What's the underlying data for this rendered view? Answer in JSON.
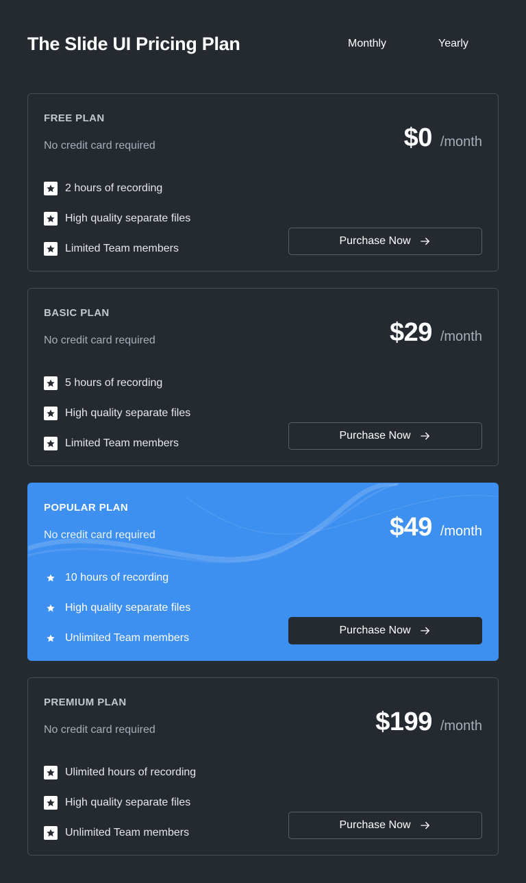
{
  "header": {
    "title": "The Slide UI Pricing Plan",
    "toggle": {
      "monthly_label": "Monthly",
      "yearly_label": "Yearly"
    }
  },
  "plans": [
    {
      "name": "FREE PLAN",
      "subtitle": "No credit card required",
      "price": "$0",
      "period": "/month",
      "features": [
        "2 hours of recording",
        "High quality separate files",
        "Limited Team members"
      ],
      "button_label": "Purchase Now"
    },
    {
      "name": "BASIC PLAN",
      "subtitle": "No credit card required",
      "price": "$29",
      "period": "/month",
      "features": [
        "5 hours of recording",
        "High quality separate files",
        "Limited Team members"
      ],
      "button_label": "Purchase Now"
    },
    {
      "name": "POPULAR PLAN",
      "subtitle": "No credit card required",
      "price": "$49",
      "period": "/month",
      "features": [
        "10 hours of recording",
        "High quality separate files",
        "Unlimited Team members"
      ],
      "button_label": "Purchase Now"
    },
    {
      "name": "PREMIUM PLAN",
      "subtitle": "No credit card required",
      "price": "$199",
      "period": "/month",
      "features": [
        "Ulimited hours of recording",
        "High quality separate files",
        "Unlimited Team members"
      ],
      "button_label": "Purchase Now"
    }
  ],
  "icons": {
    "feature": "star-icon",
    "button": "arrow-right-icon"
  },
  "colors": {
    "background": "#252a31",
    "accent": "#3d8ff0",
    "card_border": "#464d57"
  }
}
